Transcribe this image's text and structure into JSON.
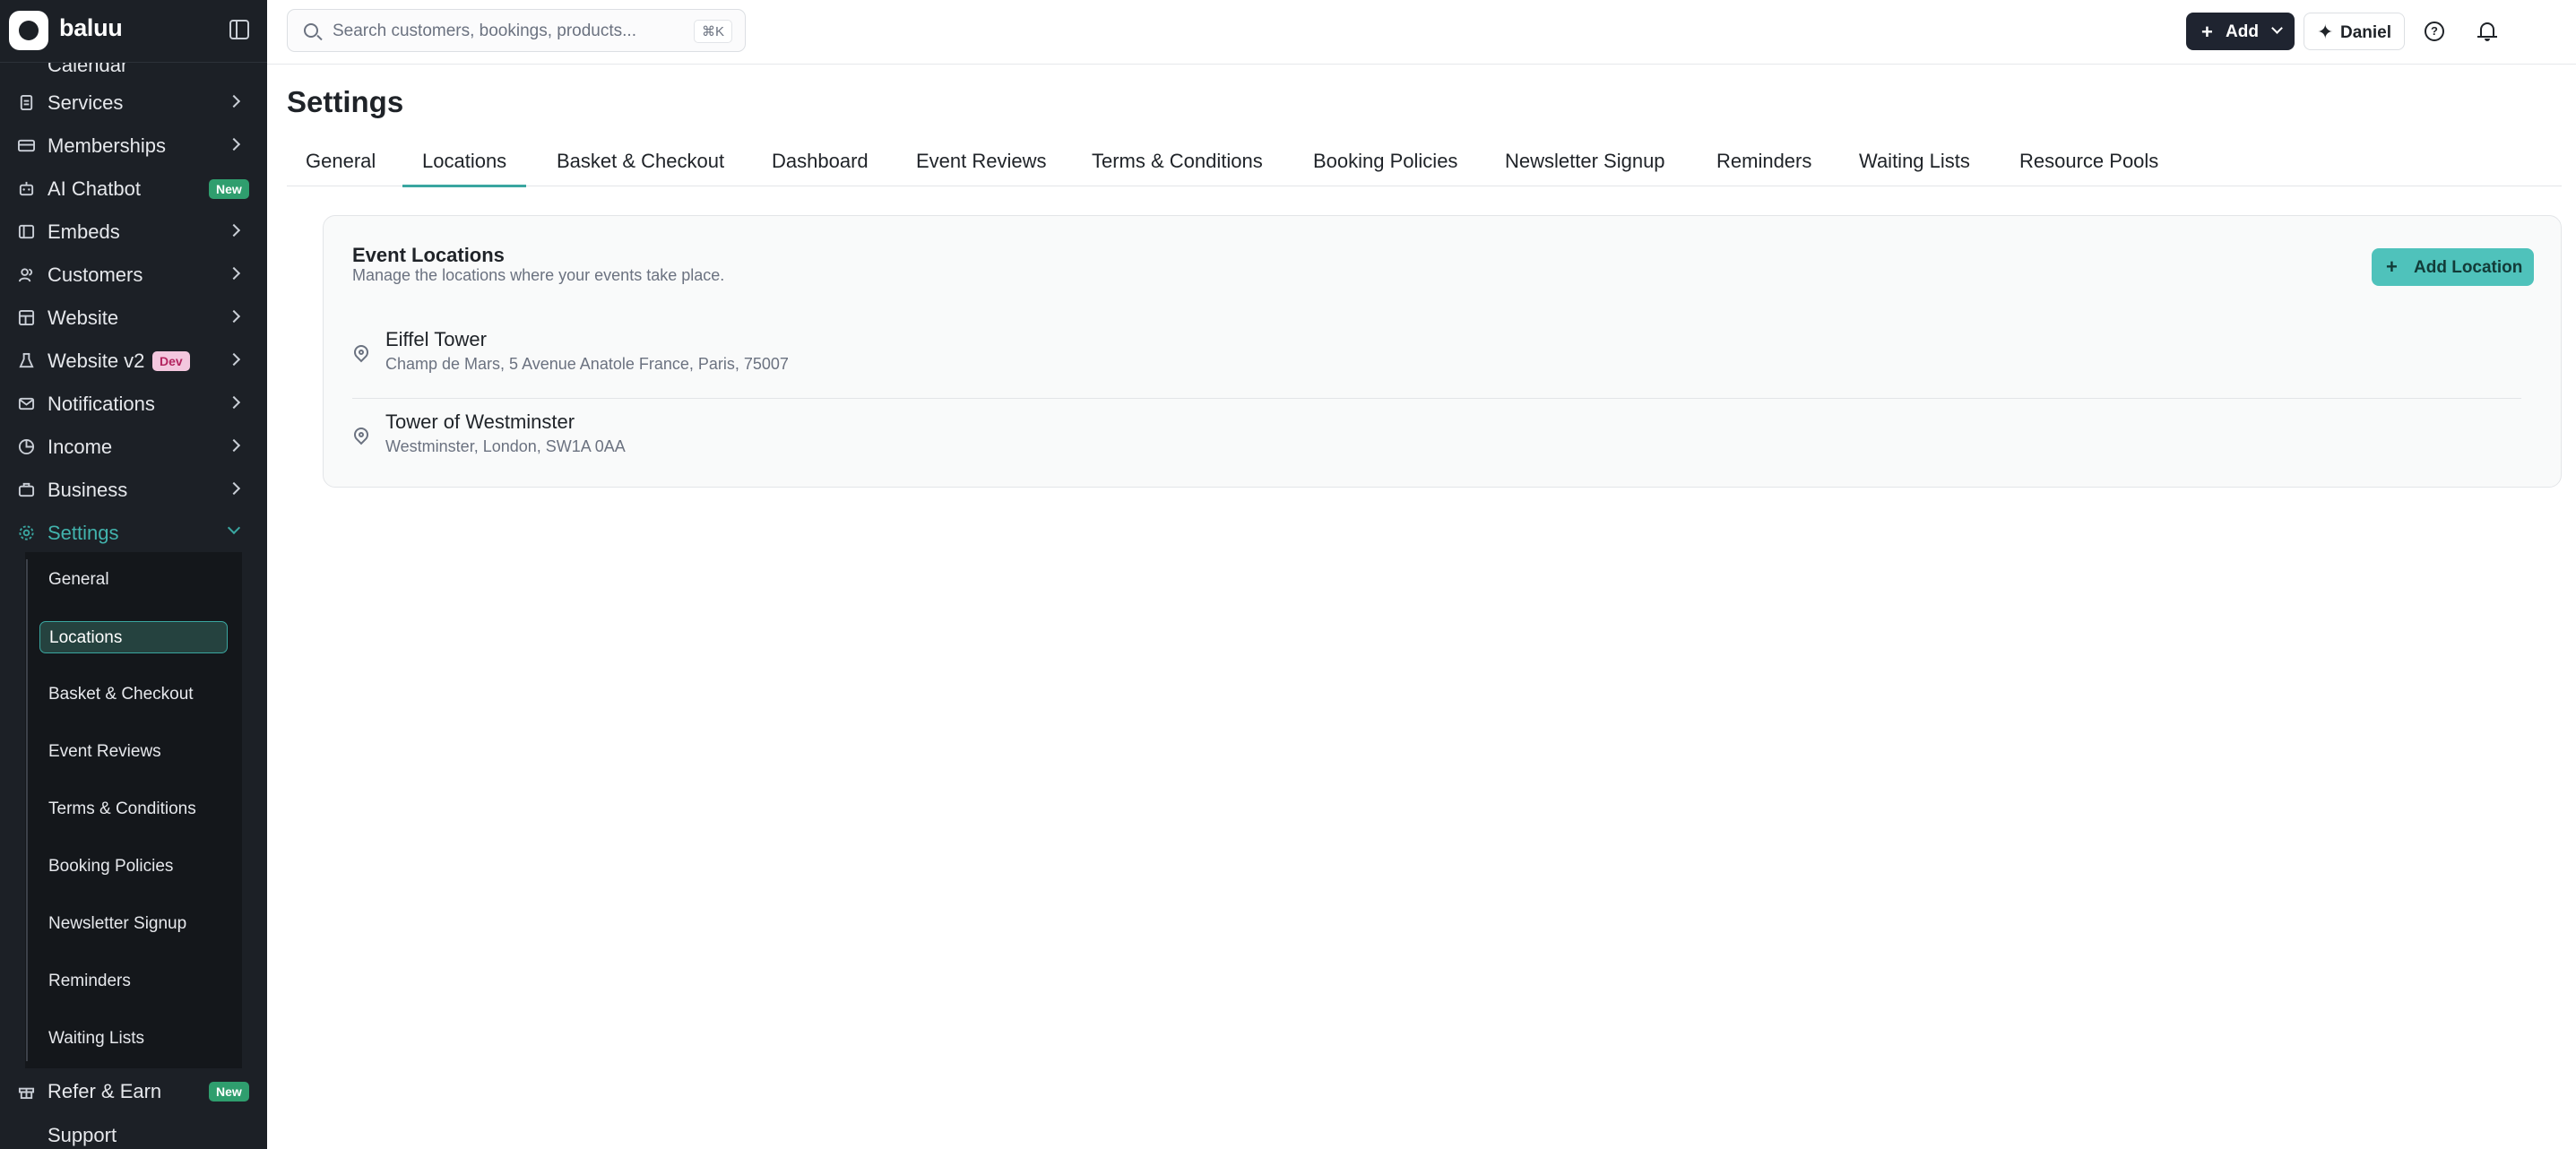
{
  "app": {
    "brand": "baluu"
  },
  "sidebar": {
    "partial_top_label": "Calendar",
    "items": [
      {
        "label": "Services",
        "icon": "document-icon"
      },
      {
        "label": "Memberships",
        "icon": "card-icon"
      },
      {
        "label": "AI Chatbot",
        "icon": "bot-icon",
        "badge": "New"
      },
      {
        "label": "Embeds",
        "icon": "embed-icon"
      },
      {
        "label": "Customers",
        "icon": "users-icon"
      },
      {
        "label": "Website",
        "icon": "layout-icon"
      },
      {
        "label": "Website v2",
        "icon": "flask-icon",
        "badge": "Dev"
      },
      {
        "label": "Notifications",
        "icon": "mail-icon"
      },
      {
        "label": "Income",
        "icon": "pie-icon"
      },
      {
        "label": "Business",
        "icon": "briefcase-icon"
      },
      {
        "label": "Settings",
        "icon": "gear-icon",
        "active": true
      }
    ],
    "settings_sub": [
      "General",
      "Locations",
      "Basket & Checkout",
      "Event Reviews",
      "Terms & Conditions",
      "Booking Policies",
      "Newsletter Signup",
      "Reminders",
      "Waiting Lists"
    ],
    "active_sub": "Locations",
    "bottom": {
      "label": "Refer & Earn",
      "icon": "gift-icon",
      "badge": "New"
    },
    "partial_bottom_label": "Support"
  },
  "topbar": {
    "search_placeholder": "Search customers, bookings, products...",
    "search_shortcut": "⌘K",
    "add_label": "Add",
    "user_name": "Daniel"
  },
  "page": {
    "title": "Settings",
    "tabs": [
      "General",
      "Locations",
      "Basket & Checkout",
      "Dashboard",
      "Event Reviews",
      "Terms & Conditions",
      "Booking Policies",
      "Newsletter Signup",
      "Reminders",
      "Waiting Lists",
      "Resource Pools"
    ],
    "active_tab": "Locations"
  },
  "card": {
    "title": "Event Locations",
    "subtitle": "Manage the locations where your events take place.",
    "add_button": "Add Location",
    "locations": [
      {
        "name": "Eiffel Tower",
        "address": "Champ de Mars, 5 Avenue Anatole France, Paris, 75007"
      },
      {
        "name": "Tower of Westminster",
        "address": "Westminster, London, SW1A 0AA"
      }
    ]
  },
  "colors": {
    "sidebar_bg": "#1c2026",
    "accent": "#3aa6a0",
    "add_location_bg": "#4fc2bb",
    "dark_button": "#1f2430"
  }
}
